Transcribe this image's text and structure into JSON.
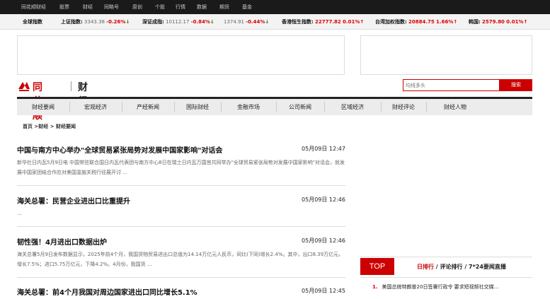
{
  "topbar": {
    "items": [
      "同花顺财经",
      "股票",
      "财经",
      "同略号",
      "原创",
      "个股",
      "行情",
      "数据",
      "期货",
      "基金"
    ]
  },
  "ticker": {
    "label": "全球指数",
    "indices": [
      {
        "name": "上证指数:",
        "value": "3343.38",
        "change": "-0.26%",
        "dir": "down"
      },
      {
        "name": "深证成指:",
        "value": "10112.17",
        "change": "-0.84%",
        "dir": "down"
      },
      {
        "name": "",
        "value": "1374.91",
        "change": "-0.44%",
        "dir": "down"
      },
      {
        "name": "香港恒生指数:",
        "value": "22777.82",
        "change": "0.01%",
        "dir": "up"
      },
      {
        "name": "台湾加权指数:",
        "value": "20884.75",
        "change": "1.66%",
        "dir": "up"
      },
      {
        "name": "韩国:",
        "value": "2579.80",
        "change": "0.01%",
        "dir": "up"
      }
    ]
  },
  "header": {
    "brand": "同花顺",
    "section": "财经",
    "search_placeholder": "均线多头",
    "search_button": "搜索"
  },
  "nav": {
    "tabs": [
      "财经要闻",
      "宏观经济",
      "产经新闻",
      "国际财经",
      "金融市场",
      "公司新闻",
      "区域经济",
      "财经评论",
      "财经人物"
    ]
  },
  "breadcrumb": "首页 >财经 > 财经要闻",
  "articles": [
    {
      "title": "中国与南方中心举办\"全球贸易紧张局势对发展中国家影响\"对话会",
      "time": "05月09日 12:47",
      "summary": "新华社日内瓦5月9日电 中国常驻联合国日内瓦代表团与南方中心8日在瑞士日内瓦万国宫共同举办\"全球贸易紧张局势对发展中国家影响\"对话会，就发展中国家团结合作应对美国滥施关税行径展开讨 ..."
    },
    {
      "title": "海关总署：民营企业进出口比重提升",
      "time": "05月09日 12:46",
      "summary": "..."
    },
    {
      "title": "韧性强！4月进出口数据出炉",
      "time": "05月09日 12:46",
      "summary": "海关总署5月9日发布数据显示，2025年前4个月，我国货物贸易进出口总值为14.14万亿元人民币，同比(下同)增长2.4%。其中，出口8.39万亿元，增长7.5%；进口5.75万亿元，下降4.2%。4月份，我国货 ..."
    },
    {
      "title": "海关总署：前4个月我国对周边国家进出口同比增长5.1%",
      "time": "05月09日 12:45",
      "summary": ""
    }
  ],
  "ranking": {
    "badge": "TOP",
    "tabs": [
      "日排行",
      "评论排行",
      "7*24要闻直播"
    ],
    "items": [
      {
        "num": "1.",
        "text": "美国总统特朗普20日签署行政令 要求短视频社交媒..."
      }
    ]
  },
  "colors": {
    "accent": "#cc0000",
    "up": "#dd0000",
    "down": "#008800"
  }
}
